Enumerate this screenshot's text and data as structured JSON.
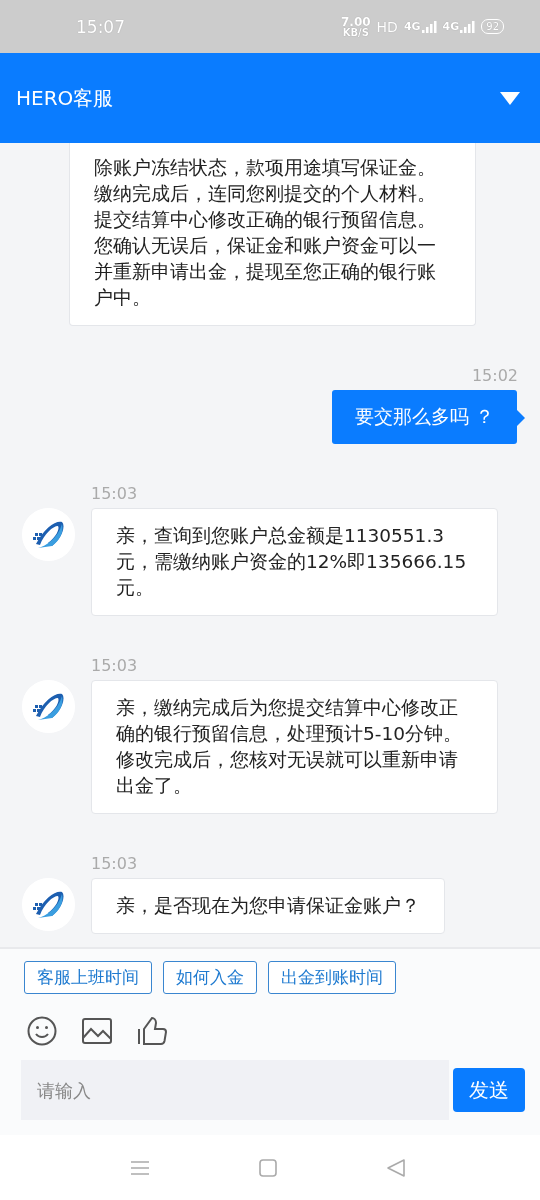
{
  "status_bar": {
    "time": "15:07",
    "speed": "7.00",
    "speed_unit": "KB/S",
    "hd": "HD",
    "network_1": "4G",
    "network_2": "4G",
    "battery": "92"
  },
  "header": {
    "title": "HERO客服"
  },
  "messages": [
    {
      "kind": "agent",
      "text": "除账户冻结状态，款项用途填写保证金。缴纳完成后，连同您刚提交的个人材料。提交结算中心修改正确的银行预留信息。您确认无误后，保证金和账户资金可以一并重新申请出金，提现至您正确的银行账户中。"
    },
    {
      "kind": "user",
      "time": "15:02",
      "text": "要交那么多吗 ？"
    },
    {
      "kind": "agent",
      "time": "15:03",
      "text": "亲，查询到您账户总金额是1130551.3元，需缴纳账户资金的12%即135666.15元。"
    },
    {
      "kind": "agent",
      "time": "15:03",
      "text": "亲，缴纳完成后为您提交结算中心修改正确的银行预留信息，处理预计5-10分钟。修改完成后，您核对无误就可以重新申请出金了。"
    },
    {
      "kind": "agent",
      "time": "15:03",
      "text": "亲，是否现在为您申请保证金账户？"
    }
  ],
  "quick_replies": [
    "客服上班时间",
    "如何入金",
    "出金到账时间"
  ],
  "input": {
    "placeholder": "请输入"
  },
  "send_button": "发送"
}
